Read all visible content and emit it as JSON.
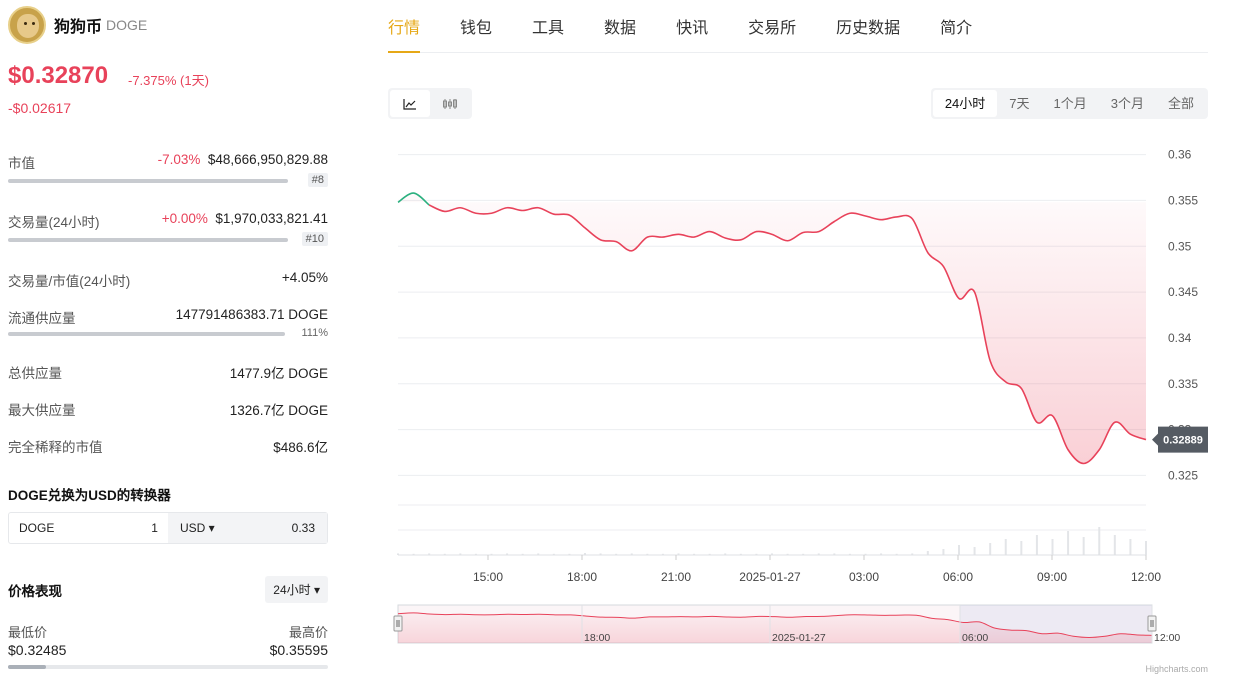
{
  "coin": {
    "name": "狗狗币",
    "symbol": "DOGE"
  },
  "price": {
    "value": "$0.32870",
    "change_pct": "-7.375% (1天)",
    "change_abs": "-$0.02617"
  },
  "stats": {
    "market_cap": {
      "label": "市值",
      "change": "-7.03%",
      "value": "$48,666,950,829.88",
      "rank": "#8"
    },
    "volume": {
      "label": "交易量(24小时)",
      "change": "+0.00%",
      "value": "$1,970,033,821.41",
      "rank": "#10"
    },
    "vol_mcap": {
      "label": "交易量/市值(24小时)",
      "value": "+4.05%"
    },
    "circulating": {
      "label": "流通供应量",
      "value": "147791486383.71 DOGE",
      "pct": "111%"
    },
    "total_supply": {
      "label": "总供应量",
      "value": "1477.9亿 DOGE"
    },
    "max_supply": {
      "label": "最大供应量",
      "value": "1326.7亿 DOGE"
    },
    "fdv": {
      "label": "完全稀释的市值",
      "value": "$486.6亿"
    }
  },
  "converter": {
    "title": "DOGE兑换为USD的转换器",
    "from_symbol": "DOGE",
    "from_amount": "1",
    "to_symbol": "USD ▾",
    "to_amount": "0.33"
  },
  "performance": {
    "title": "价格表现",
    "period": "24小时 ▾",
    "low_label": "最低价",
    "low_value": "$0.32485",
    "high_label": "最高价",
    "high_value": "$0.35595",
    "position_fraction": 0.12
  },
  "tabs": [
    "行情",
    "钱包",
    "工具",
    "数据",
    "快讯",
    "交易所",
    "历史数据",
    "简介"
  ],
  "periods": [
    "24小时",
    "7天",
    "1个月",
    "3个月",
    "全部"
  ],
  "colors": {
    "red": "#e8425a",
    "green": "#2bb07f",
    "gold": "#e6a817"
  },
  "chart_data": {
    "type": "area",
    "y_ticks": [
      "0.36",
      "0.355",
      "0.35",
      "0.345",
      "0.34",
      "0.335",
      "0.33",
      "0.325"
    ],
    "x_ticks": [
      "15:00",
      "18:00",
      "21:00",
      "2025-01-27",
      "03:00",
      "06:00",
      "09:00",
      "12:00"
    ],
    "ylim": [
      0.3245,
      0.3605
    ],
    "current_label": "0.32889",
    "navigator_labels": [
      "18:00",
      "2025-01-27",
      "06:00",
      "12:00"
    ],
    "x": [
      0,
      0.5,
      1,
      1.5,
      2,
      2.5,
      3,
      3.5,
      4,
      4.5,
      5,
      5.5,
      6,
      6.5,
      7,
      7.5,
      8,
      8.5,
      9,
      9.5,
      10,
      10.5,
      11,
      11.5,
      12,
      12.5,
      13,
      13.5,
      14,
      14.5,
      15,
      15.5,
      16,
      16.5,
      17,
      17.5,
      18,
      18.5,
      19,
      19.5,
      20,
      20.5,
      21,
      21.5,
      22,
      22.5,
      23,
      23.5,
      24
    ],
    "y": [
      0.3548,
      0.3558,
      0.3545,
      0.3538,
      0.3542,
      0.3536,
      0.3536,
      0.3542,
      0.3539,
      0.3542,
      0.3535,
      0.3534,
      0.352,
      0.3507,
      0.3505,
      0.3495,
      0.351,
      0.351,
      0.3513,
      0.351,
      0.3516,
      0.3509,
      0.3507,
      0.3516,
      0.3513,
      0.3506,
      0.3515,
      0.3516,
      0.3527,
      0.3536,
      0.3533,
      0.3529,
      0.3532,
      0.353,
      0.3493,
      0.3478,
      0.3443,
      0.345,
      0.3375,
      0.3352,
      0.3345,
      0.3308,
      0.3315,
      0.3278,
      0.3263,
      0.3278,
      0.3308,
      0.3295,
      0.3289
    ],
    "volume": [
      0.4,
      0.3,
      0.4,
      0.3,
      0.4,
      0.3,
      0.3,
      0.4,
      0.3,
      0.4,
      0.3,
      0.3,
      0.5,
      0.4,
      0.3,
      0.4,
      0.3,
      0.3,
      0.4,
      0.3,
      0.3,
      0.4,
      0.3,
      0.3,
      0.4,
      0.3,
      0.3,
      0.4,
      0.4,
      0.3,
      0.3,
      0.4,
      0.3,
      0.4,
      1.0,
      1.5,
      2.5,
      2.0,
      3.0,
      4.0,
      3.5,
      5.0,
      4.0,
      6.0,
      4.5,
      7.0,
      5.0,
      4.0,
      3.5
    ]
  }
}
